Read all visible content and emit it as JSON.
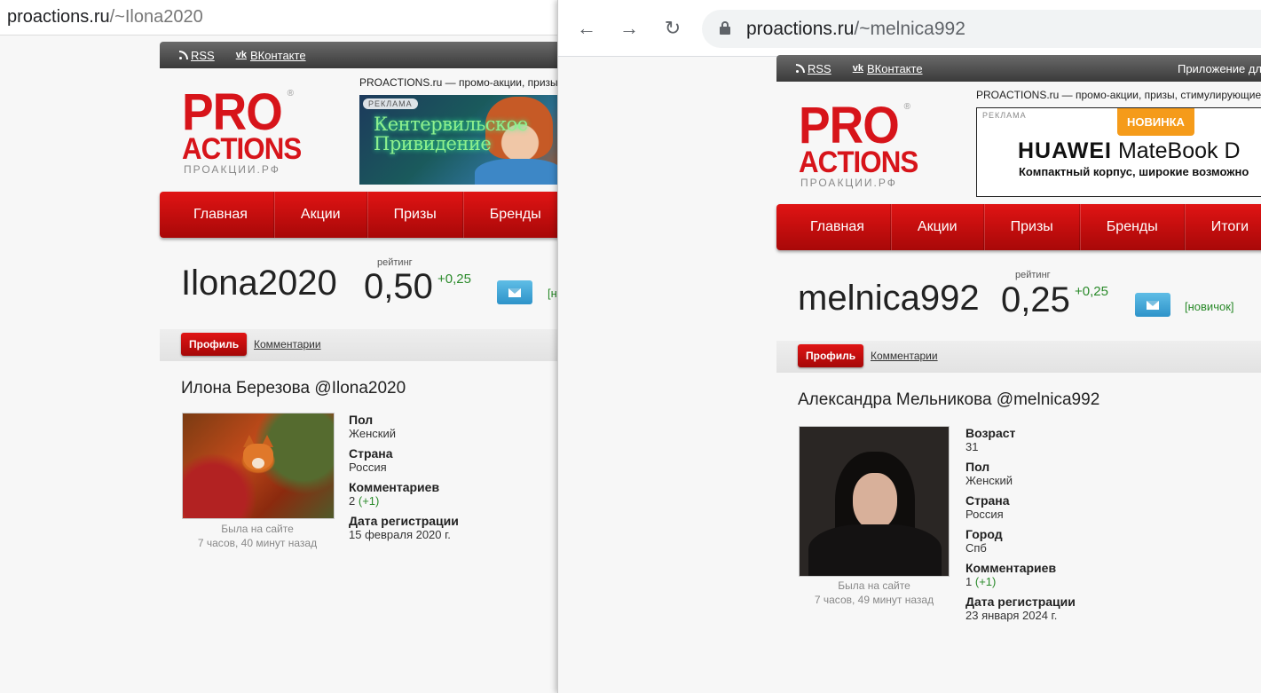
{
  "left": {
    "url_host": "proactions.ru",
    "url_path": "/~Ilona2020",
    "topbar": {
      "rss": "RSS",
      "vk": "ВКонтакте"
    },
    "tagline": "PROACTIONS.ru — промо-акции, призы",
    "logo": {
      "line1": "PRO",
      "line2": "ACTIONS",
      "line3": "ПРОАКЦИИ.РФ",
      "reg": "®"
    },
    "ad": {
      "badge": "РЕКЛАМА",
      "title": "Кентервильское Привидение"
    },
    "menu": [
      "Главная",
      "Акции",
      "Призы",
      "Бренды"
    ],
    "username": "Ilona2020",
    "rating_label": "рейтинг",
    "rating": "0,50",
    "rating_delta": "+0,25",
    "status": "[н",
    "tabs": {
      "active": "Профиль",
      "comments": "Комментарии"
    },
    "fullname": "Илона Березова @Ilona2020",
    "seen_line1": "Была на сайте",
    "seen_line2": "7 часов, 40 минут назад",
    "fields": [
      {
        "label": "Пол",
        "value": "Женский"
      },
      {
        "label": "Страна",
        "value": "Россия"
      },
      {
        "label": "Комментариев",
        "value": "2",
        "extra": "(+1)"
      },
      {
        "label": "Дата регистрации",
        "value": "15 февраля 2020 г."
      }
    ]
  },
  "right": {
    "url_host": "proactions.ru",
    "url_path": "/~melnica992",
    "topbar": {
      "rss": "RSS",
      "vk": "ВКонтакте",
      "app": "Приложение дл"
    },
    "tagline": "PROACTIONS.ru — промо-акции, призы, стимулирующие",
    "logo": {
      "line1": "PRO",
      "line2": "ACTIONS",
      "line3": "ПРОАКЦИИ.РФ",
      "reg": "®"
    },
    "ad": {
      "badge": "РЕКЛАМА",
      "new": "НОВИНКА",
      "brand_bold": "HUAWEI",
      "brand_rest": " MateBook D",
      "sub": "Компактный корпус, широкие возможно"
    },
    "menu": [
      "Главная",
      "Акции",
      "Призы",
      "Бренды",
      "Итоги"
    ],
    "username": "melnica992",
    "rating_label": "рейтинг",
    "rating": "0,25",
    "rating_delta": "+0,25",
    "status": "[новичок]",
    "tabs": {
      "active": "Профиль",
      "comments": "Комментарии"
    },
    "fullname": "Александра Мельникова @melnica992",
    "seen_line1": "Была на сайте",
    "seen_line2": "7 часов, 49 минут назад",
    "fields": [
      {
        "label": "Возраст",
        "value": "31"
      },
      {
        "label": "Пол",
        "value": "Женский"
      },
      {
        "label": "Страна",
        "value": "Россия"
      },
      {
        "label": "Город",
        "value": "Спб"
      },
      {
        "label": "Комментариев",
        "value": "1",
        "extra": "(+1)"
      },
      {
        "label": "Дата регистрации",
        "value": "23 января 2024 г."
      }
    ]
  },
  "icons": {
    "back": "back-arrow-icon",
    "forward": "forward-arrow-icon",
    "reload": "reload-icon",
    "lock": "lock-icon",
    "rss": "rss-icon",
    "vk": "vk-icon",
    "message": "envelope-icon"
  },
  "colors": {
    "brand_red": "#d7141a",
    "menu_red": "#c40e0e",
    "positive": "#2a8a2a",
    "msg_button": "#3aa3d6",
    "ad_badge": "#f59b1a"
  }
}
